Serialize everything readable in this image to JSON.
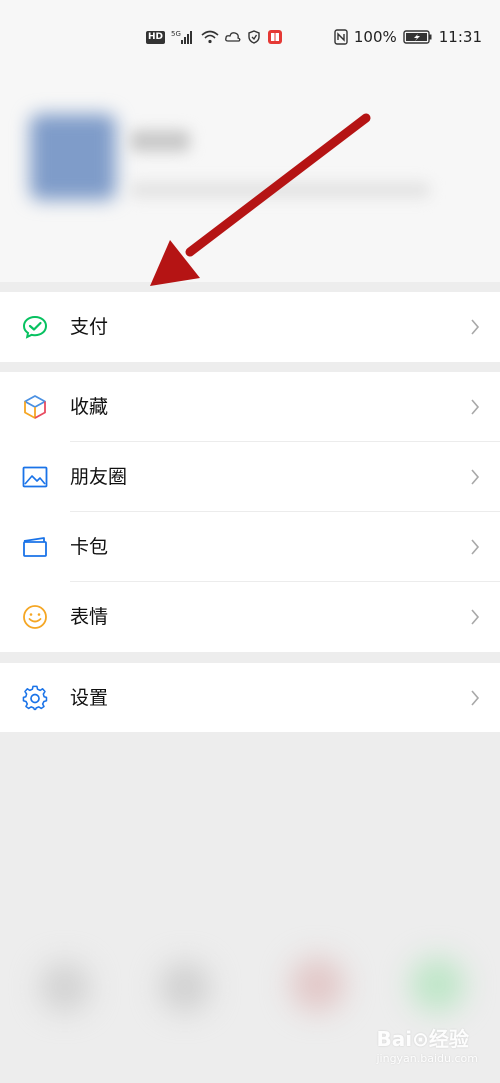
{
  "status_bar": {
    "hd_label": "HD",
    "network_label": "5G",
    "battery_percent": "100%",
    "time": "11:31"
  },
  "menu": {
    "pay": {
      "label": "支付",
      "icon": "pay-icon"
    },
    "favorites": {
      "label": "收藏",
      "icon": "favorites-icon"
    },
    "moments": {
      "label": "朋友圈",
      "icon": "moments-image-icon"
    },
    "card_wallet": {
      "label": "卡包",
      "icon": "card-wallet-icon"
    },
    "stickers": {
      "label": "表情",
      "icon": "smiley-icon"
    },
    "settings": {
      "label": "设置",
      "icon": "gear-icon"
    }
  },
  "watermark": {
    "brand": "Bai⊙经验",
    "sub": "jingyan.baidu.com"
  },
  "colors": {
    "pay_green": "#07c160",
    "arrow_red": "#b51414",
    "icon_blue": "#1a73e8",
    "smiley_orange": "#f5a623"
  }
}
